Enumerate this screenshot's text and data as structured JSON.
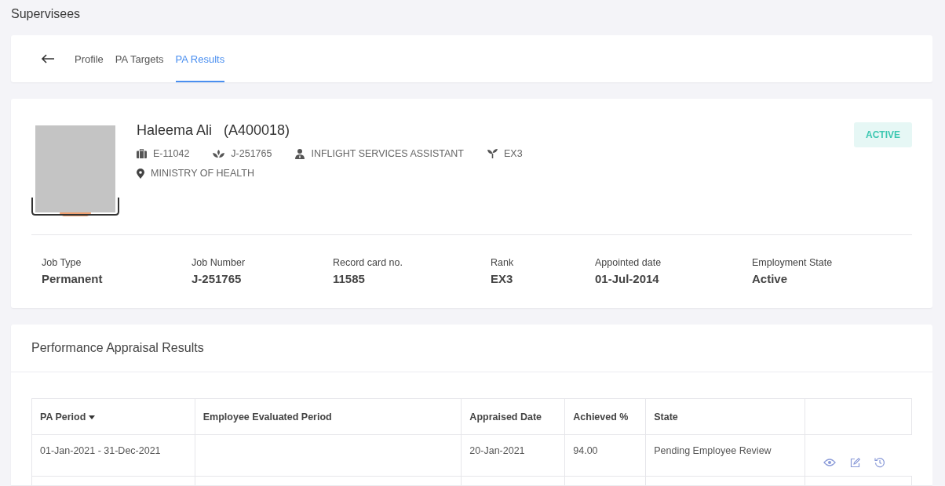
{
  "page_title": "Supervisees",
  "tabs": [
    {
      "label": "Profile",
      "selected": false
    },
    {
      "label": "PA Targets",
      "selected": false
    },
    {
      "label": "PA Results",
      "selected": true
    }
  ],
  "profile": {
    "name": "Haleema Ali",
    "code": "(A400018)",
    "status": "ACTIVE",
    "meta": [
      {
        "kind": "briefcase",
        "text": "E-11042"
      },
      {
        "kind": "lotus",
        "text": "J-251765"
      },
      {
        "kind": "person",
        "text": "INFLIGHT SERVICES ASSISTANT"
      },
      {
        "kind": "sprout",
        "text": "EX3"
      },
      {
        "kind": "pin",
        "text": "MINISTRY OF HEALTH"
      }
    ],
    "details": [
      {
        "label": "Job Type",
        "value": "Permanent"
      },
      {
        "label": "Job Number",
        "value": "J-251765"
      },
      {
        "label": "Record card no.",
        "value": "11585"
      },
      {
        "label": "Rank",
        "value": "EX3"
      },
      {
        "label": "Appointed date",
        "value": "01-Jul-2014"
      },
      {
        "label": "Employment State",
        "value": "Active"
      }
    ]
  },
  "results": {
    "title": "Performance Appraisal Results",
    "columns": [
      {
        "label": "PA Period",
        "sorted": true
      },
      {
        "label": "Employee Evaluated Period",
        "sorted": false
      },
      {
        "label": "Appraised Date",
        "sorted": false
      },
      {
        "label": "Achieved %",
        "sorted": false
      },
      {
        "label": "State",
        "sorted": false
      },
      {
        "sorted": false
      }
    ],
    "rows": [
      {
        "cells": [
          "01-Jan-2021 - 31-Dec-2021",
          "",
          "20-Jan-2021",
          "94.00",
          "Pending Employee Review"
        ],
        "actions": [
          {
            "kind": "view"
          },
          {
            "kind": "edit"
          },
          {
            "kind": "history"
          }
        ]
      }
    ]
  }
}
